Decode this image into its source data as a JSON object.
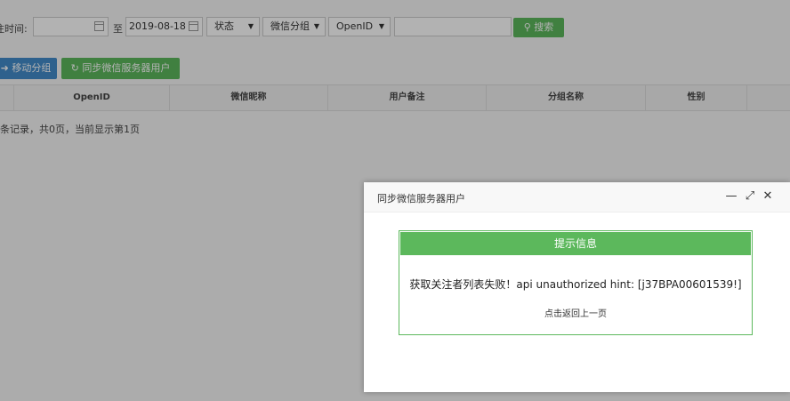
{
  "filter": {
    "time_label": "注时间:",
    "start_date": "",
    "to_label": "至",
    "end_date": "2019-08-18",
    "status": "状态",
    "group": "微信分组",
    "openid": "OpenID",
    "openid_value": "",
    "search_label": "搜索"
  },
  "toolbar": {
    "move_label": "移动分组",
    "sync_label": "同步微信服务器用户"
  },
  "table": {
    "columns": [
      "",
      "OpenID",
      "微信昵称",
      "用户备注",
      "分组名称",
      "性别",
      ""
    ]
  },
  "pagination": {
    "text": "条记录，共0页，当前显示第1页"
  },
  "dialog": {
    "title": "同步微信服务器用户",
    "message_title": "提示信息",
    "message": "获取关注者列表失败！api unauthorized hint: [j37BPA00601539!]",
    "back_link": "点击返回上一页"
  },
  "colors": {
    "green": "#5cb85c",
    "blue": "#428bca"
  },
  "icons": [
    "calendar-icon",
    "caret-down-icon",
    "search-icon",
    "arrow-right-icon",
    "refresh-icon",
    "minimize-icon",
    "maximize-icon",
    "close-icon"
  ]
}
